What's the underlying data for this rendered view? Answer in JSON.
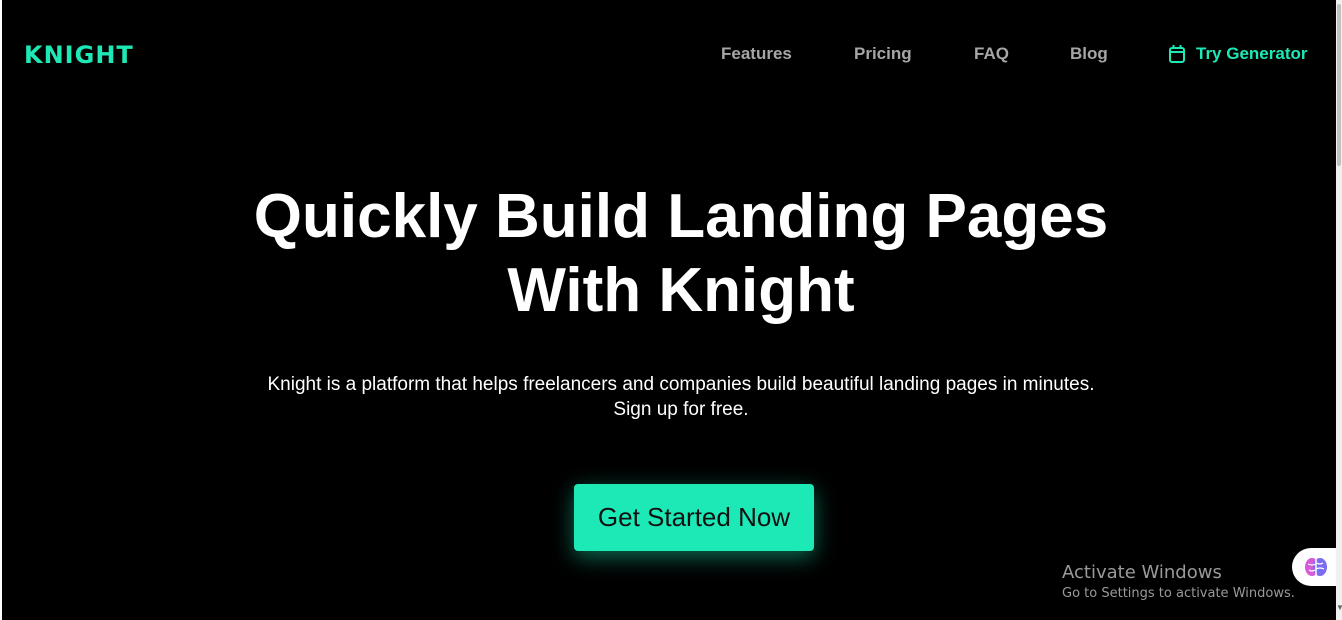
{
  "brand": {
    "logo_text": "KNIGHT",
    "accent_color": "#1de9b6"
  },
  "nav": {
    "features": "Features",
    "pricing": "Pricing",
    "faq": "FAQ",
    "blog": "Blog",
    "try_generator": "Try Generator",
    "try_generator_icon": "calendar-icon"
  },
  "hero": {
    "headline_line1": "Quickly Build Landing Pages",
    "headline_line2": "With Knight",
    "subtext_line1": "Knight is a platform that helps freelancers and companies build beautiful landing pages in minutes.",
    "subtext_line2": "Sign up for free.",
    "cta_label": "Get Started Now"
  },
  "overlay": {
    "activate_title": "Activate Windows",
    "activate_sub": "Go to Settings to activate Windows.",
    "widget_icon": "brain-icon"
  }
}
